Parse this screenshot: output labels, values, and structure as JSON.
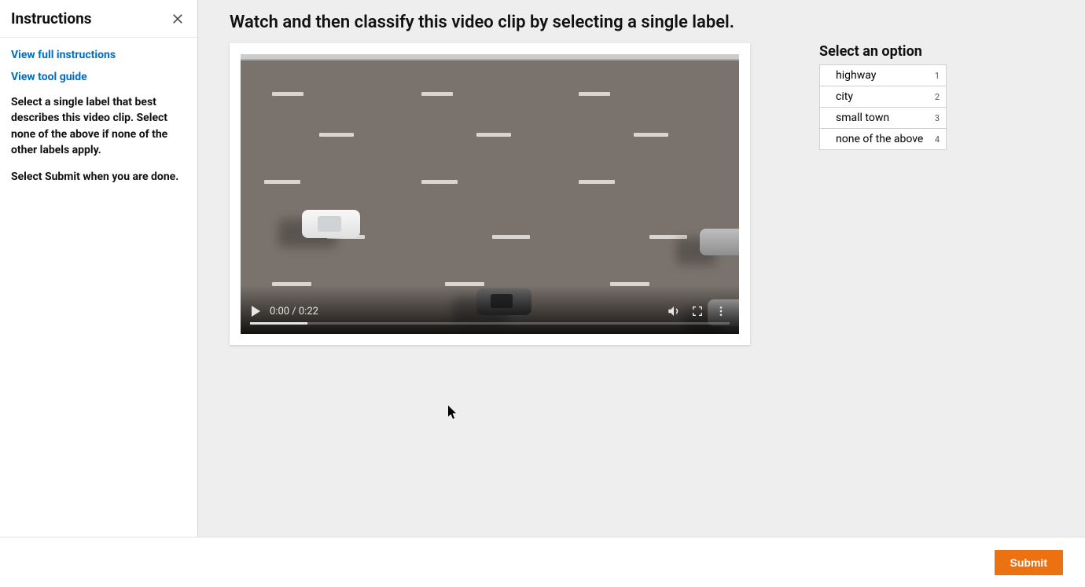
{
  "sidebar": {
    "title": "Instructions",
    "links": {
      "full_instructions": "View full instructions",
      "tool_guide": "View tool guide"
    },
    "paragraph1": "Select a single label that best describes this video clip. Select none of the above if none of the other labels apply.",
    "paragraph2": "Select Submit when you are done."
  },
  "task": {
    "title": "Watch and then classify this video clip by selecting a single label."
  },
  "video": {
    "time": "0:00 / 0:22"
  },
  "options": {
    "title": "Select an option",
    "items": [
      {
        "label": "highway",
        "hotkey": "1"
      },
      {
        "label": "city",
        "hotkey": "2"
      },
      {
        "label": "small town",
        "hotkey": "3"
      },
      {
        "label": "none of the above",
        "hotkey": "4"
      }
    ]
  },
  "footer": {
    "submit": "Submit"
  }
}
